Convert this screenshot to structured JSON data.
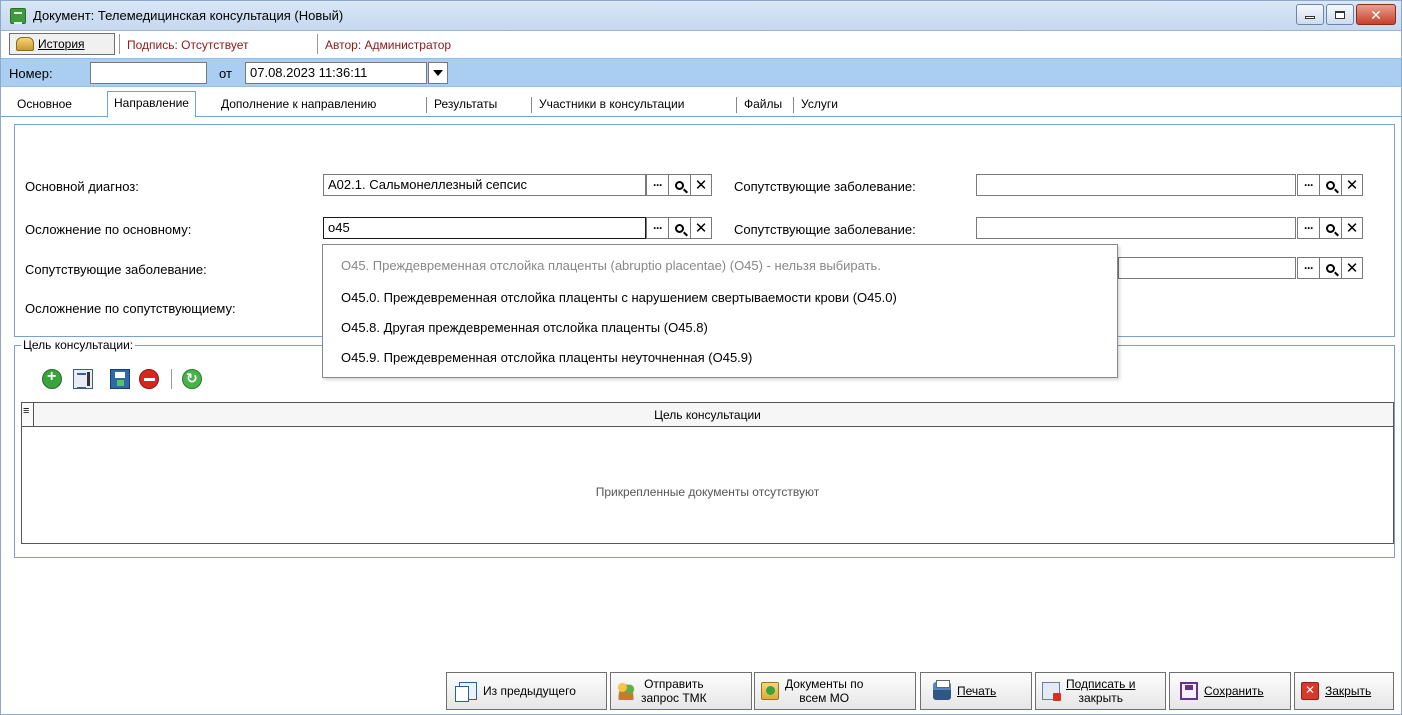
{
  "window": {
    "title": "Документ: Телемедицинская консультация (Новый)"
  },
  "toolbar": {
    "history_label": "История",
    "signature_label": "Подпись: Отсутствует",
    "author_label": "Автор: Администратор"
  },
  "header_fields": {
    "number_label": "Номер:",
    "number_value": "",
    "from_label": "от",
    "date_value": "07.08.2023 11:36:11"
  },
  "tabs": [
    {
      "label": "Основное"
    },
    {
      "label": "Направление"
    },
    {
      "label": "Дополнение к направлению"
    },
    {
      "label": "Результаты"
    },
    {
      "label": "Участники в консультации"
    },
    {
      "label": "Файлы"
    },
    {
      "label": "Услуги"
    }
  ],
  "diagnosis": {
    "main_label": "Основной диагноз:",
    "main_value": "A02.1. Сальмонеллезный сепсис",
    "complication_label": "Осложнение по основному:",
    "complication_value": "o45",
    "concomitant_label": "Сопутствующие заболевание:",
    "concomitant_complication_label": "Осложнение по сопутствующиему:",
    "right_label_1": "Сопутствующие заболевание:",
    "right_label_2": "Сопутствующие заболевание:",
    "right_value_1": "",
    "right_value_2": "",
    "right_value_3": ""
  },
  "popup": {
    "items": [
      {
        "label": "O45. Преждевременная отслойка плаценты (abruptio placentae) (O45) - нельзя выбирать.",
        "disabled": true
      },
      {
        "label": "O45.0. Преждевременная отслойка плаценты с нарушением свертываемости крови (O45.0)",
        "disabled": false
      },
      {
        "label": "O45.8. Другая преждевременная отслойка плаценты (O45.8)",
        "disabled": false
      },
      {
        "label": "O45.9. Преждевременная отслойка плаценты неуточненная (O45.9)",
        "disabled": false
      }
    ]
  },
  "consultation": {
    "group_title": "Цель консультации:",
    "column_header": "Цель консультации",
    "empty_text": "Прикрепленные документы отсутствуют"
  },
  "bottom_buttons": {
    "from_previous": "Из предыдущего",
    "send_tmk_1": "Отправить",
    "send_tmk_2": "запрос ТМК",
    "docs_mo_1": "Документы по",
    "docs_mo_2": "всем МО",
    "print": "Печать",
    "sign_close_1": "Подписать и",
    "sign_close_2": "закрыть",
    "save": "Сохранить",
    "close": "Закрыть"
  }
}
